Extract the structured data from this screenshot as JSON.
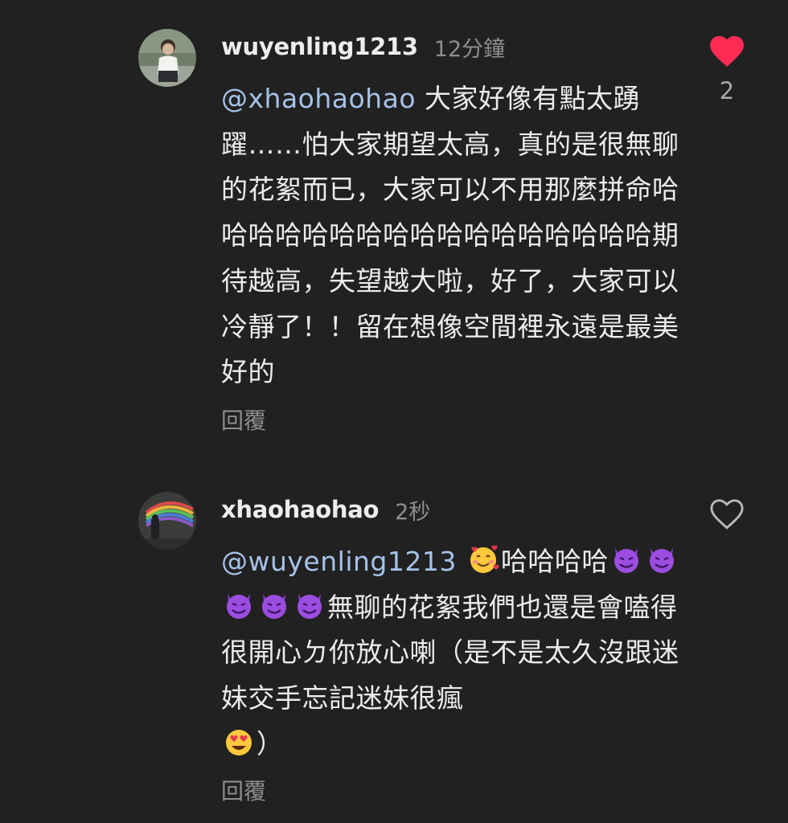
{
  "comments": [
    {
      "username": "wuyenling1213",
      "time": "12分鐘",
      "mention": "@xhaohaohao",
      "text": "大家好像有點太踴躍……怕大家期望太高，真的是很無聊的花絮而已，大家可以不用那麼拼命哈哈哈哈哈哈哈哈哈哈哈哈哈哈哈哈哈期待越高，失望越大啦，好了，大家可以冷靜了！！留在想像空間裡永遠是最美好的",
      "reply_label": "回覆",
      "likes": "2",
      "liked": true
    },
    {
      "username": "xhaohaohao",
      "time": "2秒",
      "mention": "@wuyenling1213",
      "text_part1": "哈哈哈哈",
      "text_part2": "無聊的花絮我們也還是會嗑得很開心ㄉ你放心喇（是不是太久沒跟迷妹交手忘記迷妹很瘋",
      "text_part3": "）",
      "reply_label": "回覆",
      "liked": false
    }
  ],
  "icons": {
    "heart_filled": "heart-filled-icon",
    "heart_outline": "heart-outline-icon",
    "smiling_hearts": "smiling-face-with-hearts-icon",
    "devil": "smiling-devil-icon",
    "heart_eyes": "heart-eyes-icon"
  },
  "colors": {
    "background": "#212121",
    "like_red": "#fe2c55",
    "mention": "#a6c2e8",
    "muted": "#8e8e8e"
  }
}
